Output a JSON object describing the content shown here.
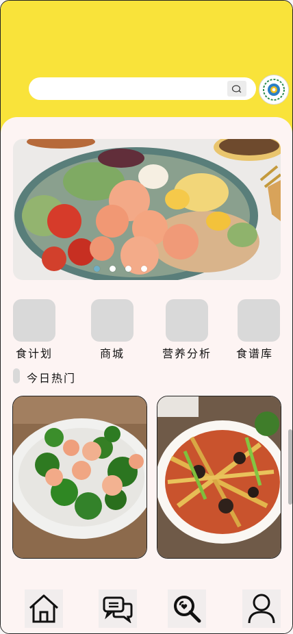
{
  "search": {
    "placeholder": ""
  },
  "categories": [
    {
      "label": "食计划"
    },
    {
      "label": "商城"
    },
    {
      "label": "营养分析"
    },
    {
      "label": "食谱库"
    }
  ],
  "section": {
    "title": "今日热门"
  },
  "banner": {
    "dots": 4,
    "active_dot": 0
  },
  "nav": [
    {
      "name": "home"
    },
    {
      "name": "messages"
    },
    {
      "name": "search"
    },
    {
      "name": "profile"
    }
  ],
  "colors": {
    "header": "#f9e33a",
    "background": "#fdf4f3",
    "tile": "#d9d9d9"
  }
}
